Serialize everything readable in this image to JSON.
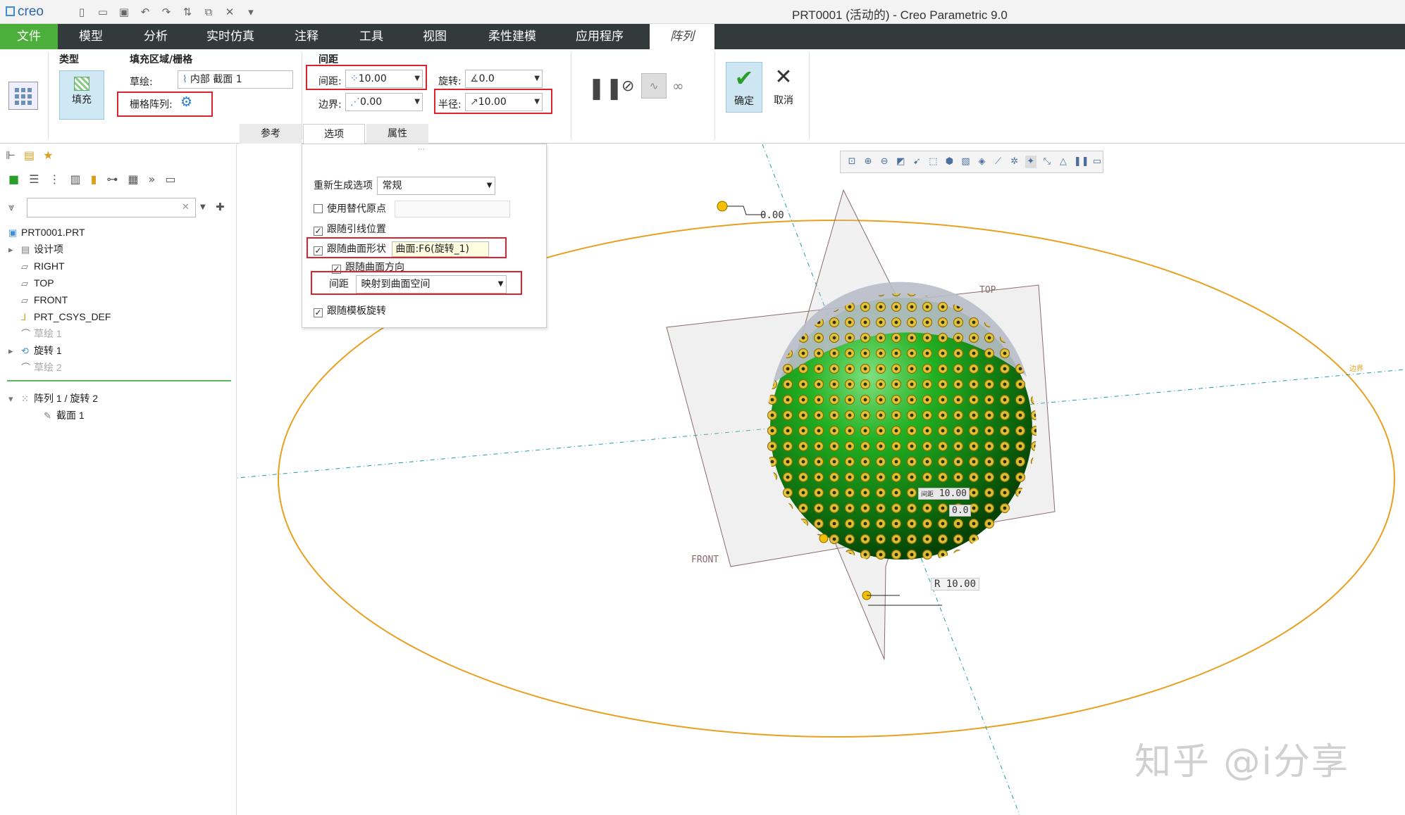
{
  "title_bar": {
    "logo": "creo",
    "window_title": "PRT0001 (活动的) - Creo Parametric 9.0"
  },
  "menu": {
    "tabs": [
      "文件",
      "模型",
      "分析",
      "实时仿真",
      "注释",
      "工具",
      "视图",
      "柔性建模",
      "应用程序",
      "阵列"
    ]
  },
  "ribbon": {
    "type_group": {
      "title": "类型",
      "fill_label": "填充"
    },
    "fill_group": {
      "title": "填充区域/栅格",
      "sketch_label": "草绘:",
      "sketch_value": "内部 截面 1",
      "grid_label": "栅格阵列:"
    },
    "spacing_group": {
      "title": "间距",
      "spacing_label": "间距:",
      "spacing_value": "10.00",
      "border_label": "边界:",
      "border_value": "0.00",
      "rotation_label": "旋转:",
      "rotation_value": "0.0",
      "radius_label": "半径:",
      "radius_value": "10.00"
    },
    "ok_label": "确定",
    "cancel_label": "取消",
    "subtabs": [
      "参考",
      "选项",
      "属性"
    ]
  },
  "options_panel": {
    "regen_label": "重新生成选项",
    "regen_value": "常规",
    "use_alt_origin": "使用替代原点",
    "follow_leader": "跟随引线位置",
    "follow_surface_shape": "跟随曲面形状",
    "surface_value": "曲面:F6(旋转_1)",
    "follow_surface_dir": "跟随曲面方向",
    "spacing_label": "间距",
    "spacing_value": "映射到曲面空间",
    "follow_template_rotation": "跟随模板旋转"
  },
  "tree": {
    "search_placeholder": "",
    "items": [
      {
        "label": "PRT0001.PRT"
      },
      {
        "label": "设计项"
      },
      {
        "label": "RIGHT"
      },
      {
        "label": "TOP"
      },
      {
        "label": "FRONT"
      },
      {
        "label": "PRT_CSYS_DEF"
      },
      {
        "label": "草绘 1"
      },
      {
        "label": "旋转 1"
      },
      {
        "label": "草绘 2"
      },
      {
        "label": "阵列 1 / 旋转 2"
      },
      {
        "label": "截面 1"
      }
    ]
  },
  "viewport": {
    "dim_top": "0.00",
    "plane_top": "TOP",
    "plane_front": "FRONT",
    "dim_spacing_label": "间距",
    "dim_spacing": "10.00",
    "dim_zero": "0.0",
    "dim_radius": "R 10.00",
    "side_label": "边界"
  },
  "watermark": "知乎 @i分享",
  "colors": {
    "file_tab": "#4caf3c",
    "menubar": "#333a3c",
    "highlight_box": "#d9232d",
    "sphere_green": "#1f9e1f",
    "boundary_ellipse": "#e8a020"
  }
}
